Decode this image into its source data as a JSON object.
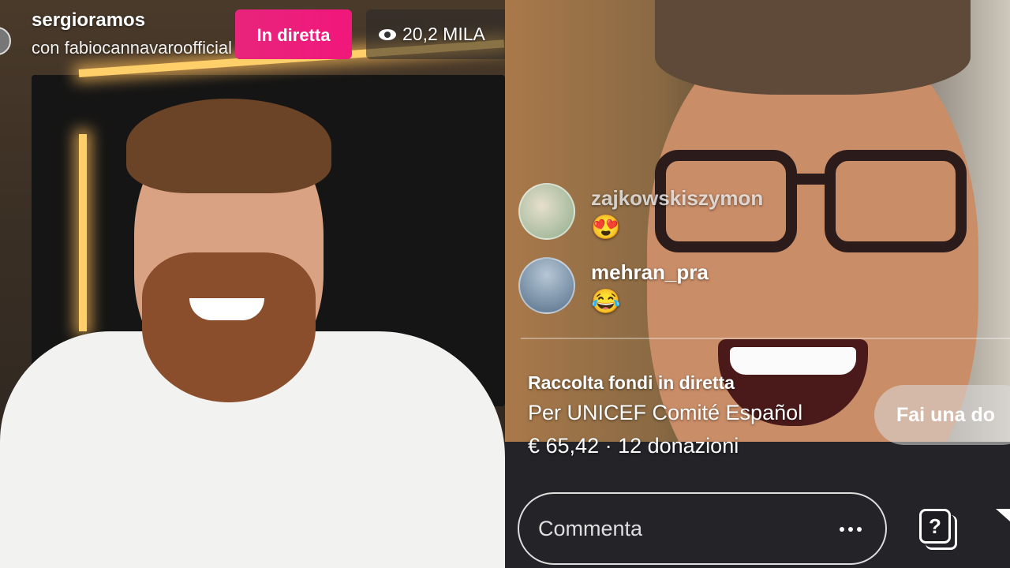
{
  "live": {
    "host": "sergioramos",
    "with_line": "con fabiocannavaroofficial",
    "badge": "In diretta",
    "viewers": "20,2 MILA"
  },
  "comments": [
    {
      "username": "zajkowskiszymon",
      "emoji": "😍"
    },
    {
      "username": "mehran_pra",
      "emoji": "😂"
    }
  ],
  "fundraiser": {
    "title": "Raccolta fondi in diretta",
    "organization": "Per UNICEF Comité Español",
    "amount": "€ 65,42 · 12 donazioni",
    "donate_label": "Fai una do"
  },
  "composer": {
    "placeholder": "Commenta"
  },
  "icons": {
    "question": "?"
  },
  "colors": {
    "live_badge": "#e8247c"
  }
}
